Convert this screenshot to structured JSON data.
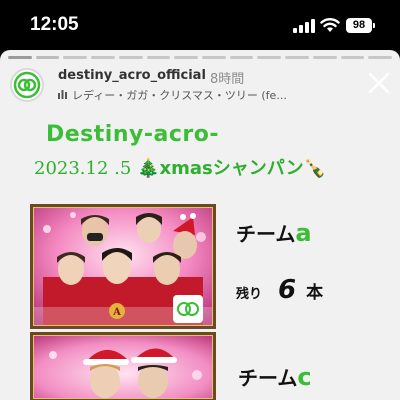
{
  "status_bar": {
    "time": "12:05",
    "battery": "98"
  },
  "story": {
    "username": "destiny_acro_official",
    "time_ago": "8時間",
    "music": "レディー・ガガ・クリスマス・ツリー (fe...",
    "avatar_text": "acro",
    "close_icon": "close-icon",
    "headline": "Destiny-acro-",
    "date": "2023.12 .5",
    "tree_emoji": "🎄",
    "event": "xmasシャンパン",
    "bottle_emoji": "🍾",
    "progress_segments": 14,
    "progress_done": 1,
    "teams": [
      {
        "prefix": "チーム",
        "letter": "a",
        "remaining_label": "残り",
        "remaining_count": "6",
        "remaining_unit": "本",
        "photo_logo": "acro"
      },
      {
        "prefix": "チーム",
        "letter": "c"
      }
    ]
  }
}
